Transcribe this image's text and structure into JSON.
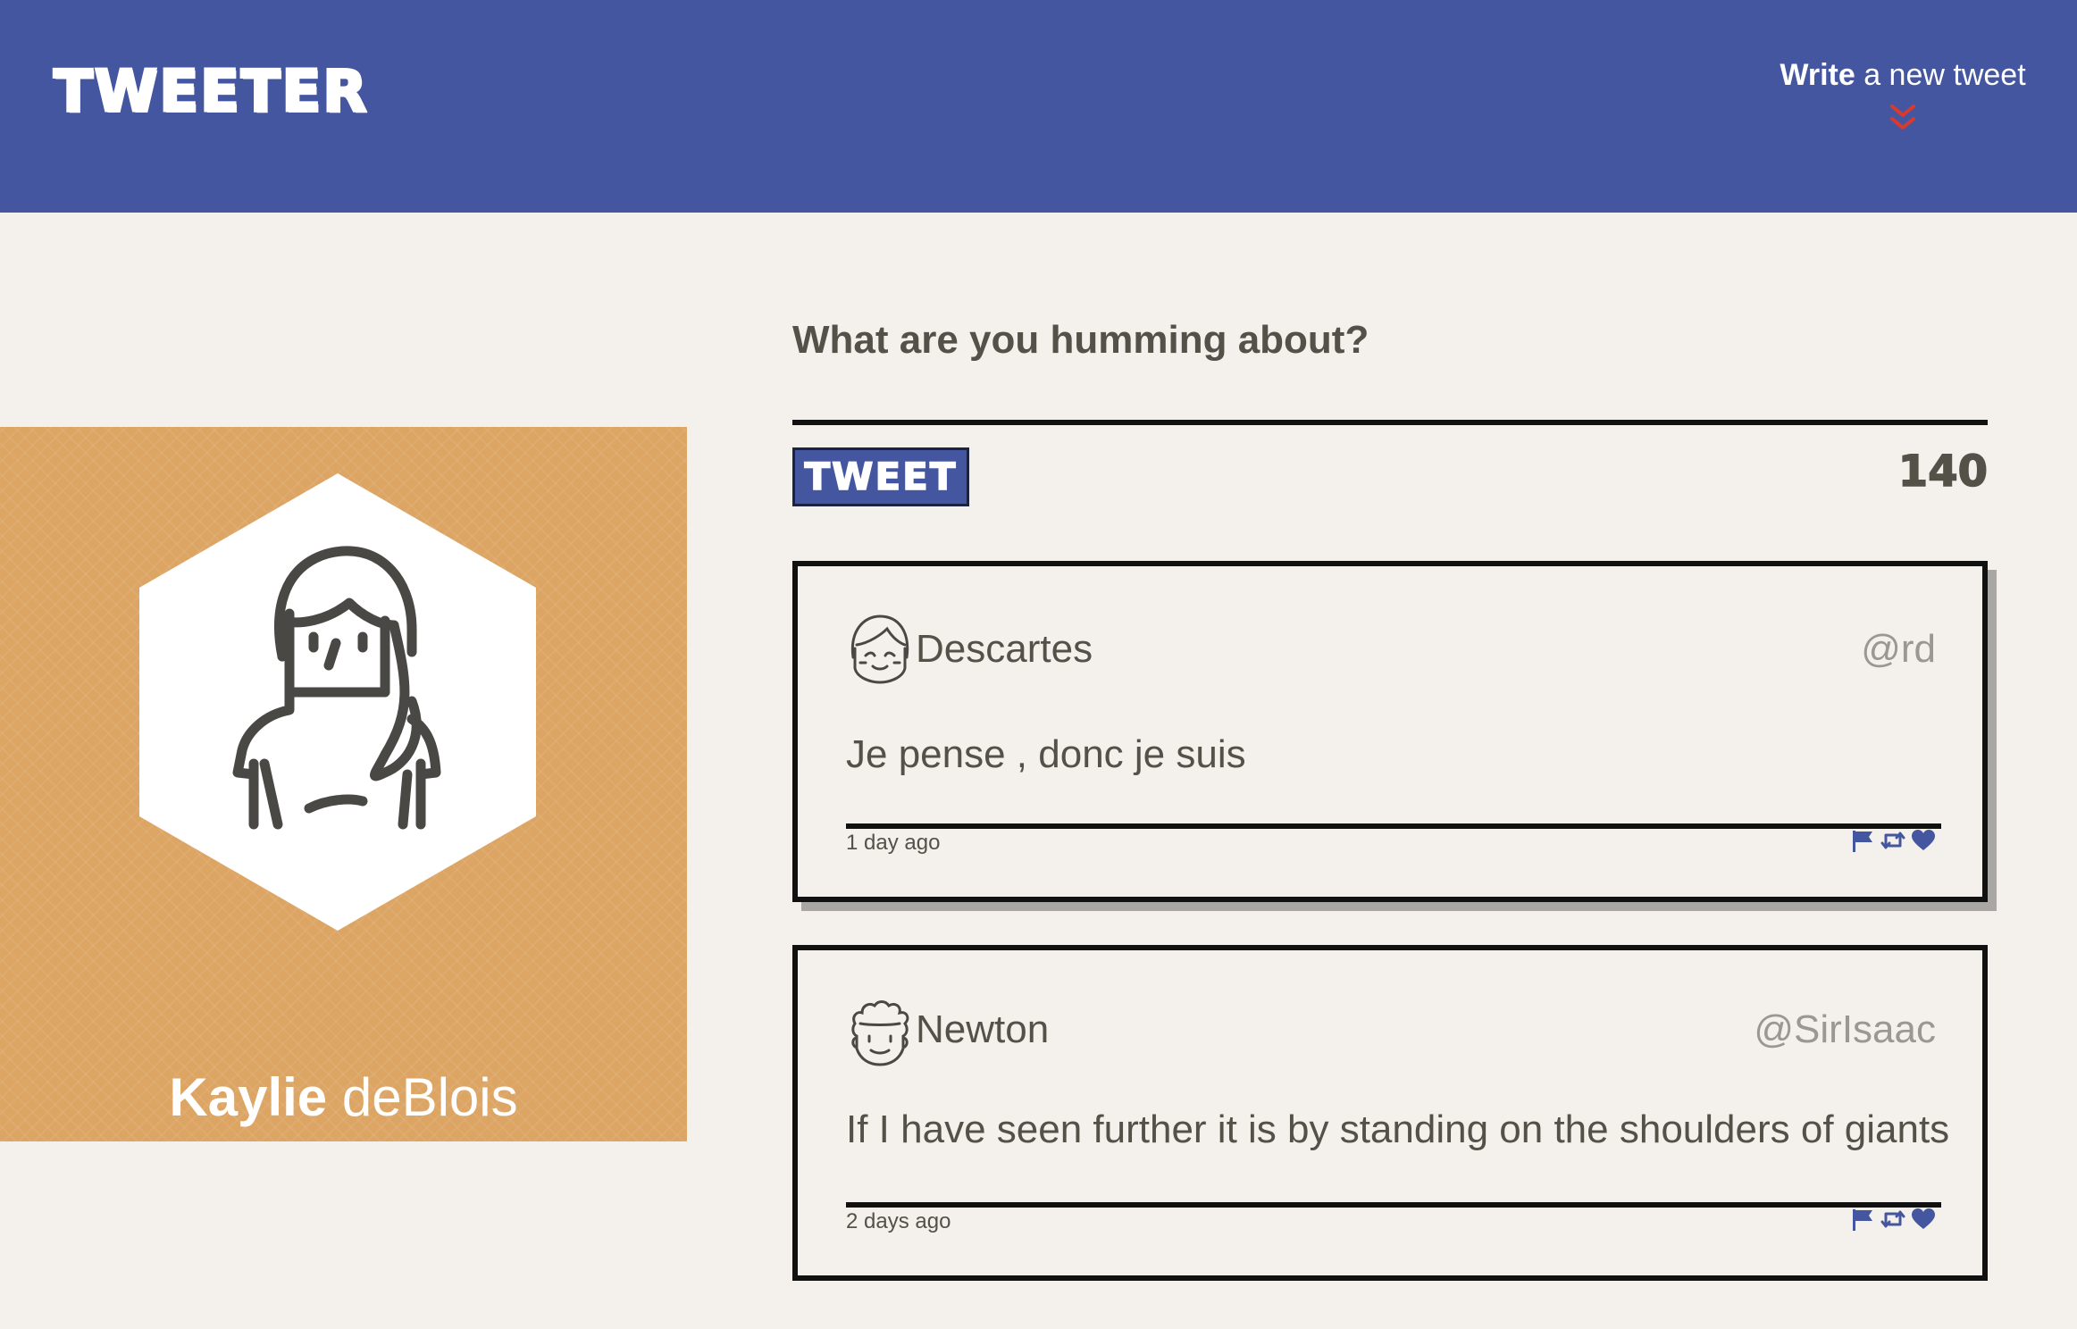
{
  "colors": {
    "nav_background": "#4556a0",
    "page_background": "#f4f1ec",
    "profile_background": "#dca564",
    "accent_red": "#d93a2e",
    "icon_blue": "#4556a0",
    "text_dark": "#545149",
    "handle_gray": "#9a9892"
  },
  "nav": {
    "brand": "TWEETER",
    "compose_bold": "Write",
    "compose_rest": " a new tweet",
    "compose_icon": "double-chevron-down-icon"
  },
  "profile": {
    "first_name": "Kaylie",
    "last_name": " deBlois",
    "avatar_icon": "woman-avatar-icon"
  },
  "composer": {
    "prompt": "What are you humming about?",
    "tweet_button": "TWEET",
    "char_count": "140"
  },
  "tweets": [
    {
      "author": "Descartes",
      "handle": "@rd",
      "text": "Je pense , donc je suis",
      "time": "1 day ago",
      "avatar_icon": "girl-avatar-icon",
      "actions": [
        "flag-icon",
        "retweet-icon",
        "heart-icon"
      ]
    },
    {
      "author": "Newton",
      "handle": "@SirIsaac",
      "text": "If I have seen further it is by standing on the shoulders of giants",
      "time": "2 days ago",
      "avatar_icon": "curly-hair-man-avatar-icon",
      "actions": [
        "flag-icon",
        "retweet-icon",
        "heart-icon"
      ]
    }
  ]
}
